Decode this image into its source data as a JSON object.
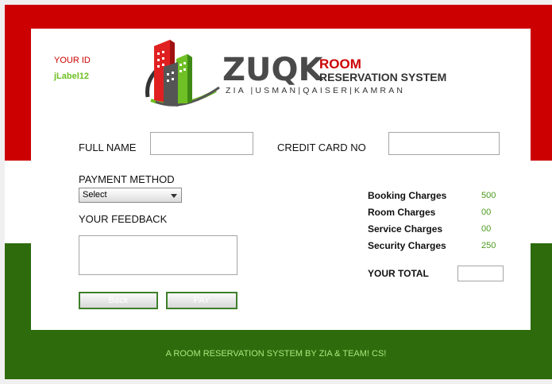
{
  "header": {
    "your_id_label": "YOUR ID",
    "id_value": "jLabel12"
  },
  "logo": {
    "brand": "ZUQK",
    "room": "ROOM",
    "reservation": "RESERVATION SYSTEM",
    "team_line": "ZIA |USMAN|QAISER|KAMRAN"
  },
  "form": {
    "full_name_label": "FULL NAME",
    "full_name_value": "",
    "credit_card_label": "CREDIT CARD NO",
    "credit_card_value": "",
    "payment_method_label": "PAYMENT METHOD",
    "payment_method_selected": "Select",
    "feedback_label": "YOUR FEEDBACK",
    "feedback_value": ""
  },
  "buttons": {
    "back_label": "Back",
    "pay_label": "PAY"
  },
  "charges": {
    "booking_label": "Booking Charges",
    "booking_value": "500",
    "room_label": "Room Charges",
    "room_value": "00",
    "service_label": "Service Charges",
    "service_value": "00",
    "security_label": "Security Charges",
    "security_value": "250",
    "total_label": "YOUR TOTAL",
    "total_value": ""
  },
  "footer": {
    "text": "A ROOM RESERVATION SYSTEM BY ZIA & TEAM! CS!"
  },
  "colors": {
    "red": "#cc0000",
    "green": "#2d6b0c",
    "accent_green": "#6fc024"
  }
}
